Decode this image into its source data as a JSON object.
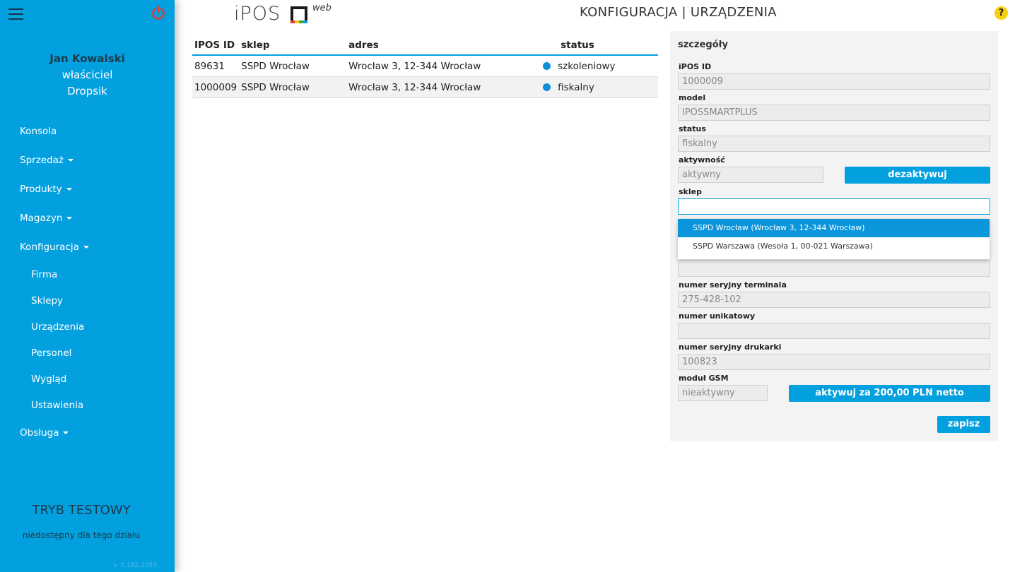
{
  "sidebar": {
    "user": {
      "name": "Jan Kowalski",
      "role": "właściciel",
      "company": "Dropsik"
    },
    "menu": [
      {
        "label": "Konsola"
      },
      {
        "label": "Sprzedaż"
      },
      {
        "label": "Produkty"
      },
      {
        "label": "Magazyn"
      },
      {
        "label": "Konfiguracja"
      },
      {
        "label": "Obsługa"
      }
    ],
    "submenu": [
      {
        "label": "Firma"
      },
      {
        "label": "Sklepy"
      },
      {
        "label": "Urządzenia"
      },
      {
        "label": "Personel"
      },
      {
        "label": "Wygląd"
      },
      {
        "label": "Ustawienia"
      }
    ],
    "test_mode": {
      "title": "TRYB TESTOWY",
      "subtitle": "niedostępny dla tego działu"
    },
    "version": "v. 6.182.2053",
    "colors": {
      "background": "#03a0e0",
      "power_icon": "#e53935"
    }
  },
  "header": {
    "logo_text": "iPOS",
    "logo_suffix": "web",
    "title": "KONFIGURACJA | URZĄDZENIA",
    "help": "?"
  },
  "table": {
    "columns": [
      "IPOS ID",
      "sklep",
      "adres",
      "status"
    ],
    "rows": [
      {
        "id": "89631",
        "shop": "SSPD Wrocław",
        "address": "Wrocław 3, 12-344 Wrocław",
        "status": "szkoleniowy"
      },
      {
        "id": "1000009",
        "shop": "SSPD Wrocław",
        "address": "Wrocław 3, 12-344 Wrocław",
        "status": "fiskalny"
      }
    ]
  },
  "details": {
    "title": "szczegóły",
    "fields": {
      "ipos_id": {
        "label": "iPOS ID",
        "value": "1000009"
      },
      "model": {
        "label": "model",
        "value": "IPOSSMARTPLUS"
      },
      "status": {
        "label": "status",
        "value": "fiskalny"
      },
      "activity": {
        "label": "aktywność",
        "value": "aktywny"
      },
      "shop": {
        "label": "sklep",
        "value": ""
      },
      "hidden_field": {
        "value": ""
      },
      "terminal_serial": {
        "label": "numer seryjny terminala",
        "value": "275-428-102"
      },
      "unique_number": {
        "label": "numer unikatowy",
        "value": ""
      },
      "printer_serial": {
        "label": "numer seryjny drukarki",
        "value": "100823"
      },
      "gsm": {
        "label": "moduł GSM",
        "value": "nieaktywny"
      }
    },
    "buttons": {
      "deactivate": "dezaktywuj",
      "activate_gsm": "aktywuj za 200,00 PLN netto",
      "save": "zapisz"
    },
    "shop_options": [
      {
        "label": "SSPD Wrocław (Wrocław 3, 12-344 Wrocław)",
        "selected": true
      },
      {
        "label": "SSPD Warszawa (Wesoła 1, 00-021 Warszawa)",
        "selected": false
      }
    ]
  }
}
